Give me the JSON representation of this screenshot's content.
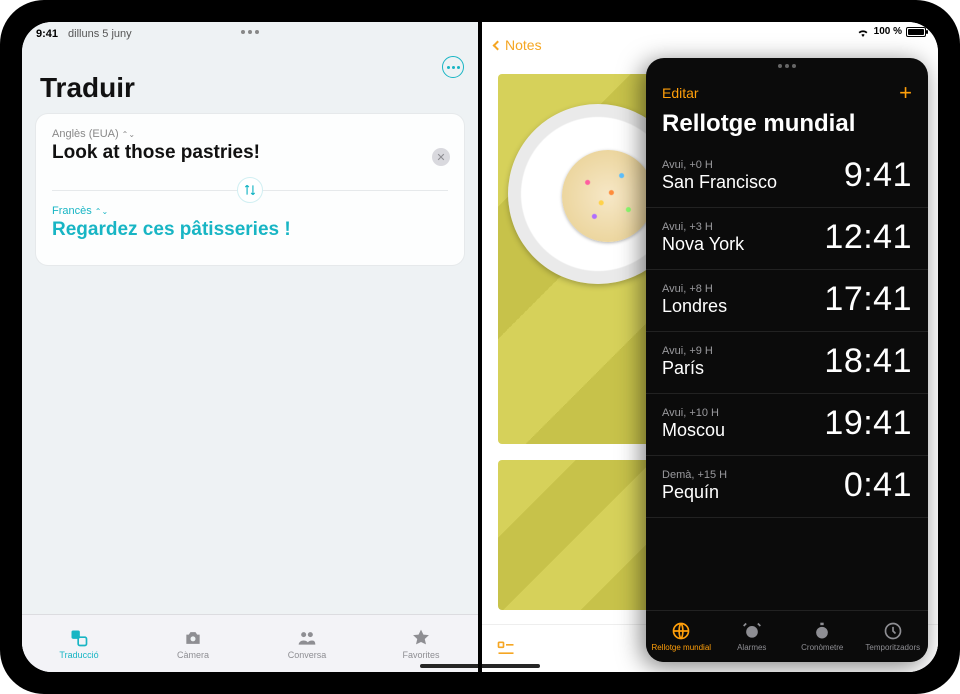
{
  "status": {
    "time": "9:41",
    "date": "dilluns 5 juny",
    "battery": "100 %"
  },
  "translate": {
    "title": "Traduir",
    "src_lang": "Anglès (EUA)",
    "src_text": "Look at those pastries!",
    "dst_lang": "Francès",
    "dst_text": "Regardez ces pâtisseries !",
    "tabs": [
      {
        "label": "Traducció"
      },
      {
        "label": "Càmera"
      },
      {
        "label": "Conversa"
      },
      {
        "label": "Favorites"
      }
    ]
  },
  "notes": {
    "back_label": "Notes"
  },
  "clock": {
    "edit": "Editar",
    "title": "Rellotge mundial",
    "rows": [
      {
        "meta": "Avui, +0 H",
        "city": "San Francisco",
        "time": "9:41"
      },
      {
        "meta": "Avui, +3 H",
        "city": "Nova York",
        "time": "12:41"
      },
      {
        "meta": "Avui, +8 H",
        "city": "Londres",
        "time": "17:41"
      },
      {
        "meta": "Avui, +9 H",
        "city": "París",
        "time": "18:41"
      },
      {
        "meta": "Avui, +10 H",
        "city": "Moscou",
        "time": "19:41"
      },
      {
        "meta": "Demà, +15 H",
        "city": "Pequín",
        "time": "0:41"
      }
    ],
    "tabs": [
      {
        "label": "Rellotge mundial"
      },
      {
        "label": "Alarmes"
      },
      {
        "label": "Cronòmetre"
      },
      {
        "label": "Temporitzadors"
      }
    ]
  }
}
